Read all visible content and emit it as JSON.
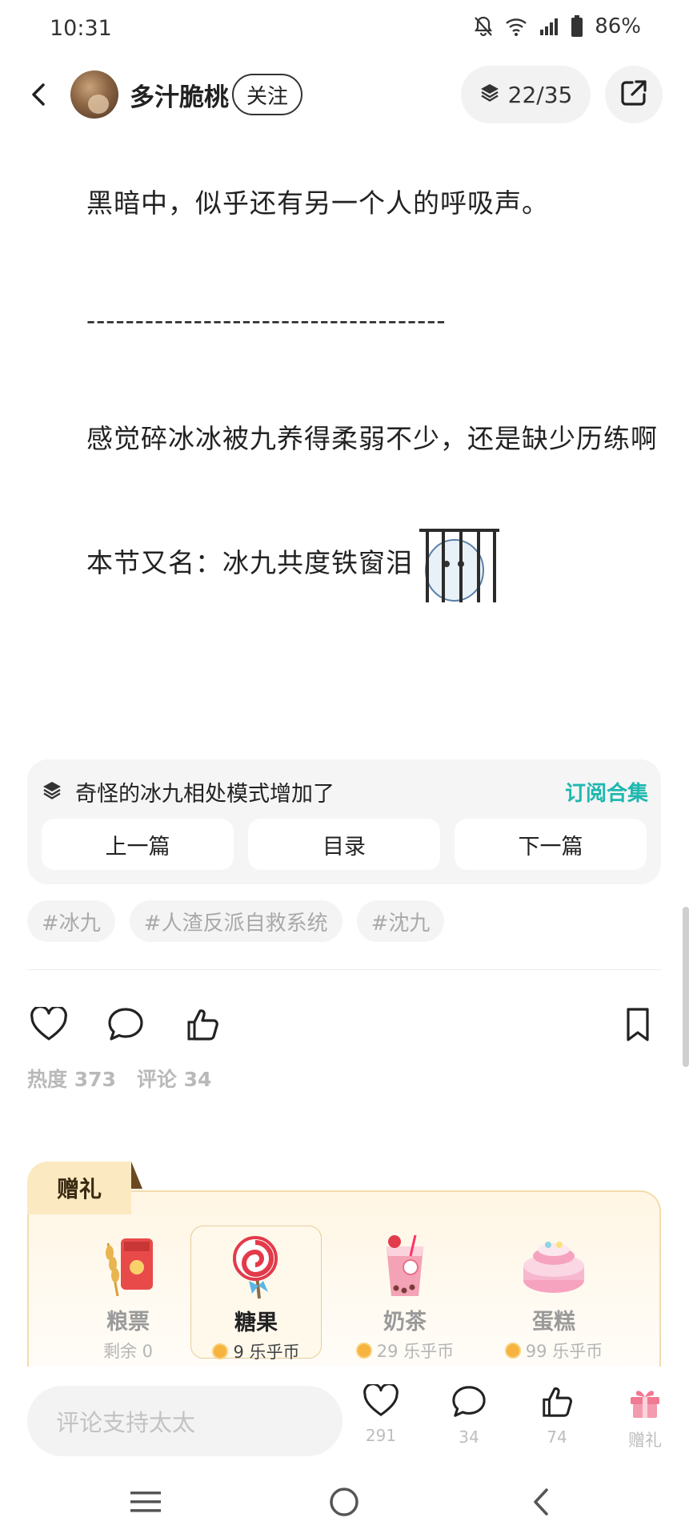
{
  "status_bar": {
    "time": "10:31",
    "battery": "86%"
  },
  "header": {
    "author_name": "多汁脆桃",
    "follow_label": "关注",
    "page_counter": "22/35"
  },
  "article": {
    "line1": "黑暗中，似乎还有另一个人的呼吸声。",
    "separator": "-------------------------------------",
    "line2": "感觉碎冰冰被九养得柔弱不少，还是缺少历练啊",
    "line3": "本节又名：冰九共度铁窗泪"
  },
  "collection": {
    "title": "奇怪的冰九相处模式增加了",
    "subscribe_label": "订阅合集",
    "prev_label": "上一篇",
    "toc_label": "目录",
    "next_label": "下一篇"
  },
  "tags": [
    "#冰九",
    "#人渣反派自救系统",
    "#沈九"
  ],
  "stats": {
    "heat": "热度 373",
    "comments": "评论 34"
  },
  "gifts": {
    "tab_label": "赠礼",
    "items": [
      {
        "name": "粮票",
        "price": "剩余 0"
      },
      {
        "name": "糖果",
        "price": "9 乐乎币"
      },
      {
        "name": "奶茶",
        "price": "29 乐乎币"
      },
      {
        "name": "蛋糕",
        "price": "99 乐乎币"
      }
    ]
  },
  "bottom_bar": {
    "comment_placeholder": "评论支持太太",
    "like_count": "291",
    "comment_count": "34",
    "recommend_count": "74",
    "gift_label": "赠礼"
  },
  "colors": {
    "accent_teal": "#1eb8b0",
    "gift_pink": "#f07a93",
    "gift_border": "#f2dcae"
  },
  "icons": [
    "bell-off-icon",
    "wifi-icon",
    "signal-icon",
    "battery-icon",
    "back-icon",
    "layers-icon",
    "share-icon",
    "heart-icon",
    "comment-icon",
    "thumbs-up-icon",
    "bookmark-icon",
    "gift-icon",
    "menu-icon",
    "home-icon",
    "nav-back-icon"
  ]
}
